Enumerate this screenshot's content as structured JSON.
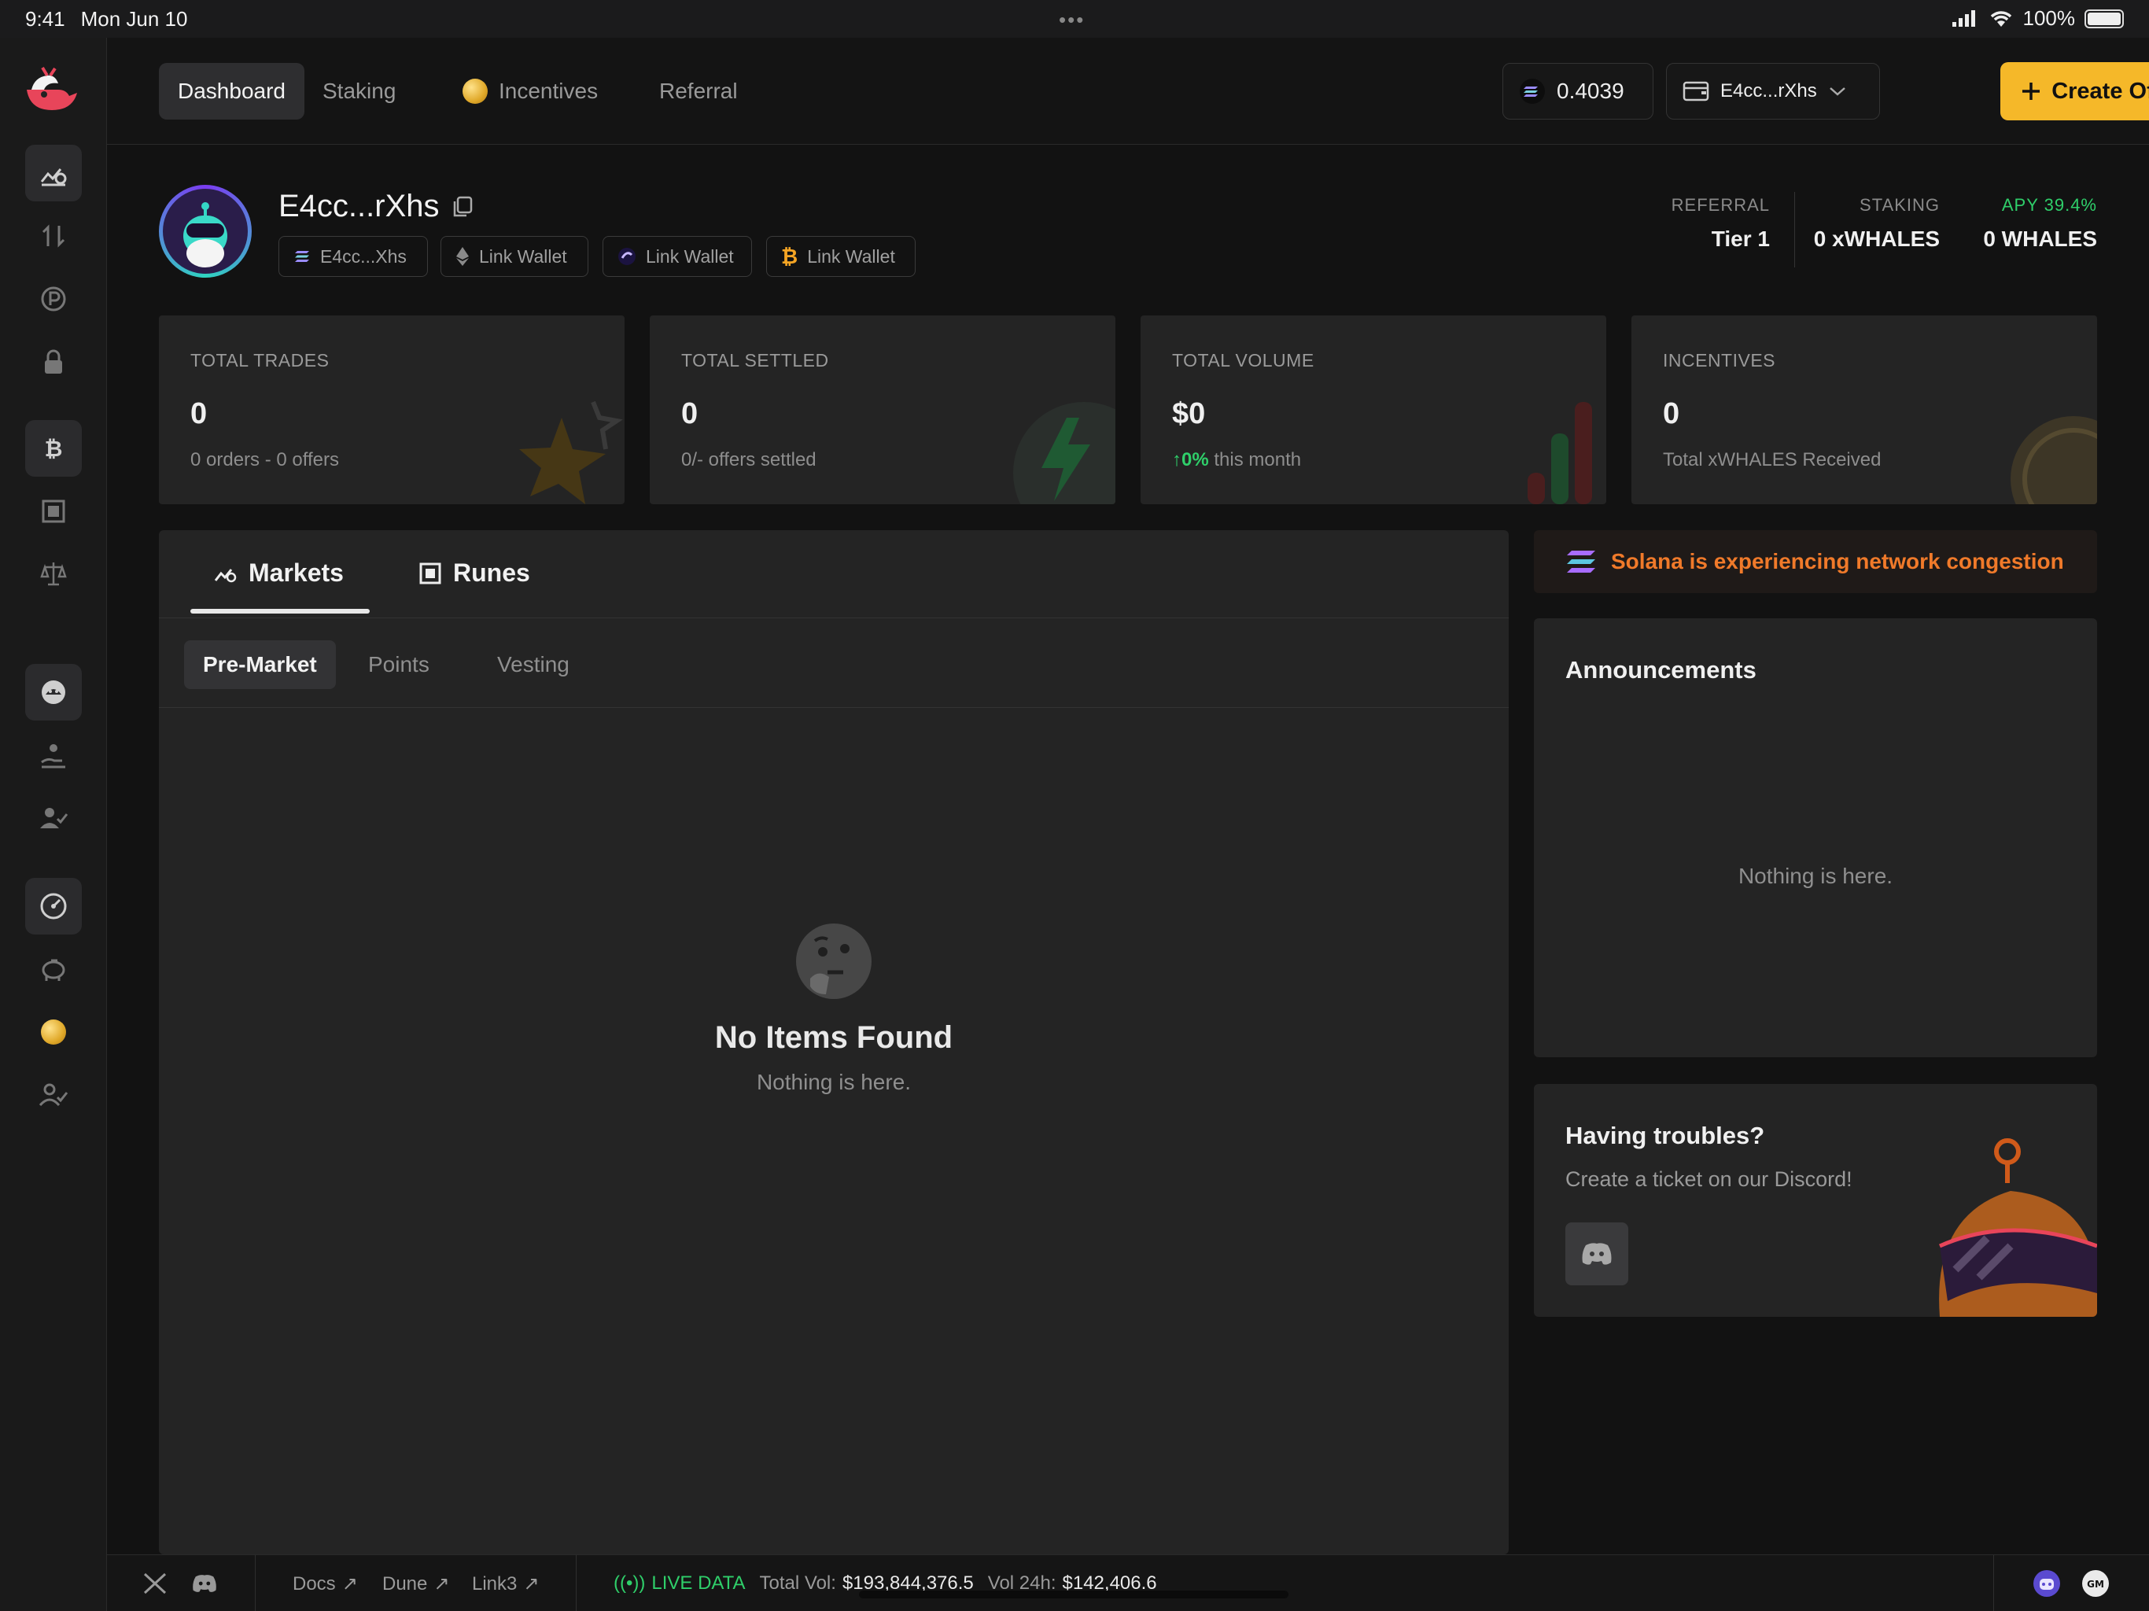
{
  "status_bar": {
    "time": "9:41",
    "date": "Mon Jun 10",
    "battery": "100%"
  },
  "nav": {
    "tabs": [
      {
        "label": "Dashboard"
      },
      {
        "label": "Staking"
      },
      {
        "label": "Incentives"
      },
      {
        "label": "Referral"
      }
    ],
    "balance": "0.4039",
    "wallet": "E4cc...rXhs",
    "create_label": "Create Offer"
  },
  "profile": {
    "name": "E4cc...rXhs",
    "chips": [
      {
        "label": "E4cc...Xhs",
        "icon": "solana-icon"
      },
      {
        "label": "Link Wallet",
        "icon": "ethereum-icon"
      },
      {
        "label": "Link Wallet",
        "icon": "sui-icon"
      },
      {
        "label": "Link Wallet",
        "icon": "bitcoin-icon"
      }
    ],
    "referral": {
      "label": "REFERRAL",
      "value": "Tier 1"
    },
    "staking": {
      "label": "STAKING",
      "value": "0 xWHALES"
    },
    "apy": {
      "label": "APY 39.4%",
      "value": "0 WHALES"
    }
  },
  "stats": [
    {
      "label": "TOTAL TRADES",
      "value": "0",
      "sub": "0 orders - 0 offers"
    },
    {
      "label": "TOTAL SETTLED",
      "value": "0",
      "sub": "0/- offers settled"
    },
    {
      "label": "TOTAL VOLUME",
      "value": "$0",
      "sub_green": "0%",
      "sub": "this month"
    },
    {
      "label": "INCENTIVES",
      "value": "0",
      "sub": "Total xWHALES Received"
    }
  ],
  "markets": {
    "tabs": [
      {
        "label": "Markets"
      },
      {
        "label": "Runes"
      }
    ],
    "subtabs": [
      {
        "label": "Pre-Market"
      },
      {
        "label": "Points"
      },
      {
        "label": "Vesting"
      }
    ],
    "empty_title": "No Items Found",
    "empty_sub": "Nothing is here."
  },
  "alert": "Solana is experiencing network congestion",
  "announcements": {
    "title": "Announcements",
    "empty": "Nothing is here."
  },
  "troubles": {
    "title": "Having troubles?",
    "sub": "Create a ticket on our Discord!"
  },
  "footer": {
    "links": [
      {
        "label": "Docs"
      },
      {
        "label": "Dune"
      },
      {
        "label": "Link3"
      }
    ],
    "live": "LIVE DATA",
    "total_vol_label": "Total Vol:",
    "total_vol": "$193,844,376.5",
    "vol24_label": "Vol 24h:",
    "vol24": "$142,406.6"
  },
  "colors": {
    "accent": "#f5b829",
    "green": "#2fcf6a",
    "alert": "#f07a2a",
    "bg": "#121212",
    "card": "#242424"
  }
}
